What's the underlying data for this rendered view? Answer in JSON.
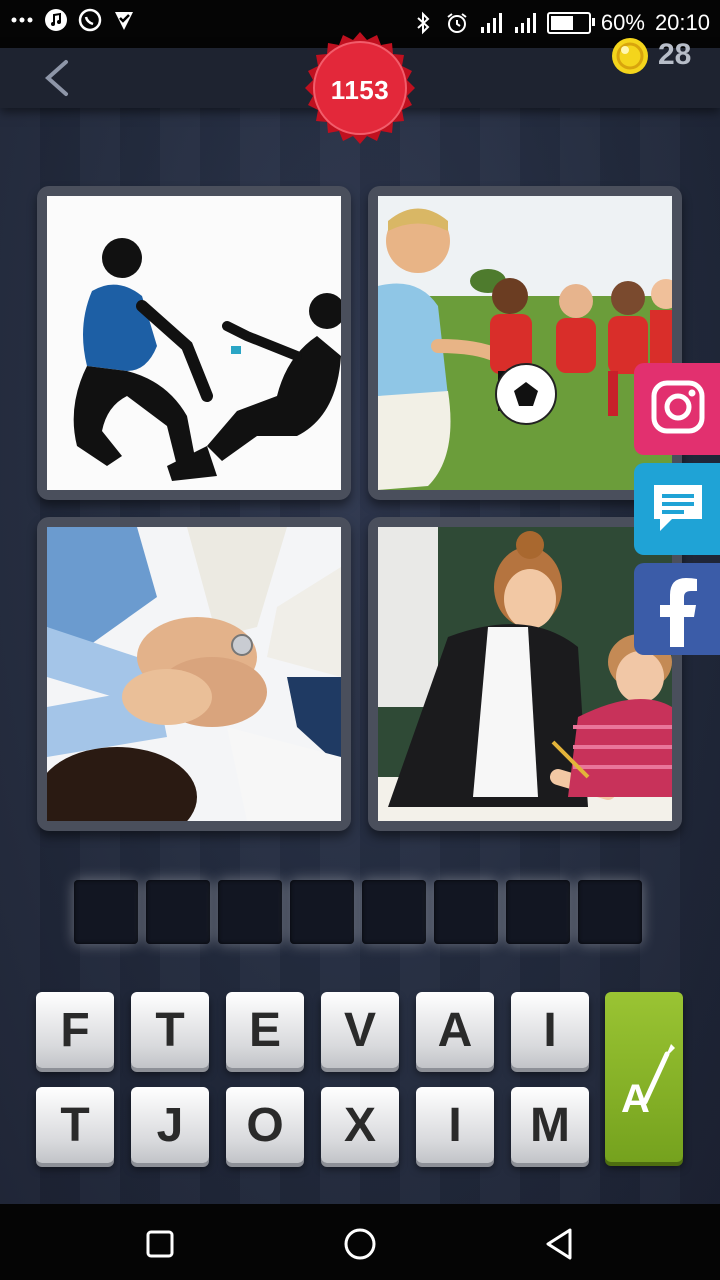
{
  "status_bar": {
    "battery": "60%",
    "time": "20:10"
  },
  "header": {
    "level": "1153",
    "coins": "28"
  },
  "pictures": [
    {
      "subject": "fitness-couple-silhouette"
    },
    {
      "subject": "kids-soccer-team"
    },
    {
      "subject": "stacked-hands"
    },
    {
      "subject": "teacher-with-child"
    }
  ],
  "answer": {
    "slots": [
      "",
      "",
      "",
      "",
      "",
      "",
      "",
      ""
    ]
  },
  "letters": {
    "row1": [
      "F",
      "T",
      "E",
      "V",
      "A",
      "I"
    ],
    "row2": [
      "T",
      "J",
      "O",
      "X",
      "I",
      "M"
    ]
  },
  "colors": {
    "badge": "#e01e2f",
    "instagram": "#e2306f",
    "message": "#1fa3d6",
    "facebook": "#3b5ca8",
    "hint": "#8ab82a"
  }
}
